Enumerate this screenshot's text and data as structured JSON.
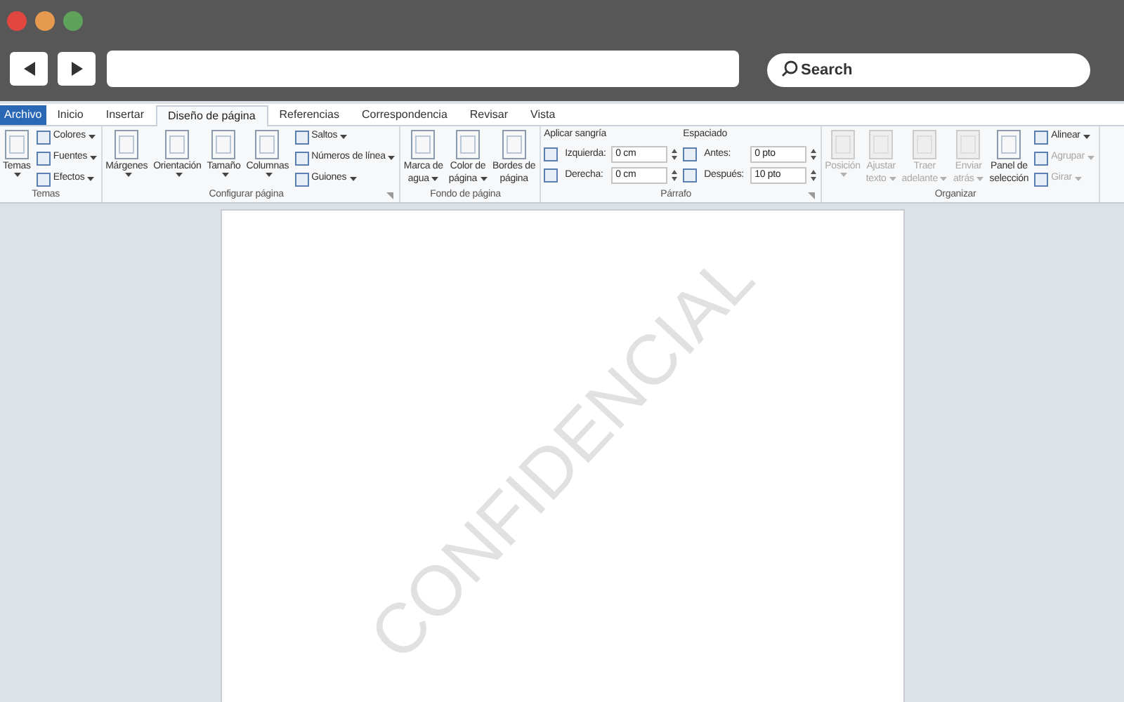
{
  "browser": {
    "search_placeholder": "Search"
  },
  "tabs": [
    {
      "label": "Archivo",
      "kind": "file",
      "selected": false
    },
    {
      "label": "Inicio",
      "kind": "tab",
      "selected": false
    },
    {
      "label": "Insertar",
      "kind": "tab",
      "selected": false
    },
    {
      "label": "Diseño de página",
      "kind": "tab",
      "selected": true
    },
    {
      "label": "Referencias",
      "kind": "tab",
      "selected": false
    },
    {
      "label": "Correspondencia",
      "kind": "tab",
      "selected": false
    },
    {
      "label": "Revisar",
      "kind": "tab",
      "selected": false
    },
    {
      "label": "Vista",
      "kind": "tab",
      "selected": false
    }
  ],
  "groups": [
    {
      "label": "Temas",
      "launcher": false,
      "columns": [
        {
          "kind": "large",
          "lines": [
            "Temas"
          ],
          "dropdown": true,
          "disabled": false
        },
        {
          "kind": "stack",
          "items": [
            {
              "kind": "small",
              "label": "Colores",
              "dropdown": true,
              "disabled": false
            },
            {
              "kind": "small",
              "label": "Fuentes",
              "dropdown": true,
              "disabled": false
            },
            {
              "kind": "small",
              "label": "Efectos",
              "dropdown": true,
              "disabled": false
            }
          ]
        }
      ]
    },
    {
      "label": "Configurar página",
      "launcher": true,
      "columns": [
        {
          "kind": "large",
          "lines": [
            "Márgenes"
          ],
          "dropdown": true,
          "disabled": false
        },
        {
          "kind": "large",
          "lines": [
            "Orientación"
          ],
          "dropdown": true,
          "disabled": false
        },
        {
          "kind": "large",
          "lines": [
            "Tamaño"
          ],
          "dropdown": true,
          "disabled": false
        },
        {
          "kind": "large",
          "lines": [
            "Columnas"
          ],
          "dropdown": true,
          "disabled": false
        },
        {
          "kind": "stack",
          "items": [
            {
              "kind": "small",
              "label": "Saltos",
              "dropdown": true,
              "disabled": false
            },
            {
              "kind": "small",
              "label": "Números de línea",
              "dropdown": true,
              "disabled": false
            },
            {
              "kind": "small",
              "label": "Guiones",
              "dropdown": true,
              "disabled": false
            }
          ]
        }
      ]
    },
    {
      "label": "Fondo de página",
      "launcher": false,
      "columns": [
        {
          "kind": "large",
          "lines": [
            "Marca de",
            "agua"
          ],
          "dropdown": true,
          "disabled": false
        },
        {
          "kind": "large",
          "lines": [
            "Color de",
            "página"
          ],
          "dropdown": true,
          "disabled": false
        },
        {
          "kind": "large",
          "lines": [
            "Bordes de",
            "página"
          ],
          "dropdown": false,
          "disabled": false
        }
      ]
    },
    {
      "label": "Párrafo",
      "launcher": true,
      "columns": [
        {
          "kind": "stack",
          "heading": "Aplicar sangría",
          "items": [
            {
              "kind": "spin",
              "label": "Izquierda:",
              "value": "0 cm"
            },
            {
              "kind": "spin",
              "label": "Derecha:",
              "value": "0 cm"
            }
          ]
        },
        {
          "kind": "stack",
          "heading": "Espaciado",
          "items": [
            {
              "kind": "spin",
              "label": "Antes:",
              "value": "0 pto"
            },
            {
              "kind": "spin",
              "label": "Después:",
              "value": "10 pto"
            }
          ]
        }
      ]
    },
    {
      "label": "Organizar",
      "launcher": false,
      "columns": [
        {
          "kind": "large",
          "lines": [
            "Posición"
          ],
          "dropdown": true,
          "disabled": true
        },
        {
          "kind": "large",
          "lines": [
            "Ajustar",
            "texto"
          ],
          "dropdown": true,
          "disabled": true
        },
        {
          "kind": "large",
          "lines": [
            "Traer",
            "adelante"
          ],
          "dropdown": true,
          "disabled": true
        },
        {
          "kind": "large",
          "lines": [
            "Enviar",
            "atrás"
          ],
          "dropdown": true,
          "disabled": true
        },
        {
          "kind": "large",
          "lines": [
            "Panel de",
            "selección"
          ],
          "dropdown": false,
          "disabled": false
        },
        {
          "kind": "stack",
          "items": [
            {
              "kind": "small",
              "label": "Alinear",
              "dropdown": true,
              "disabled": false
            },
            {
              "kind": "small",
              "label": "Agrupar",
              "dropdown": true,
              "disabled": true
            },
            {
              "kind": "small",
              "label": "Girar",
              "dropdown": true,
              "disabled": true
            }
          ]
        }
      ]
    }
  ],
  "document": {
    "watermark": "CONFIDENCIAL"
  }
}
